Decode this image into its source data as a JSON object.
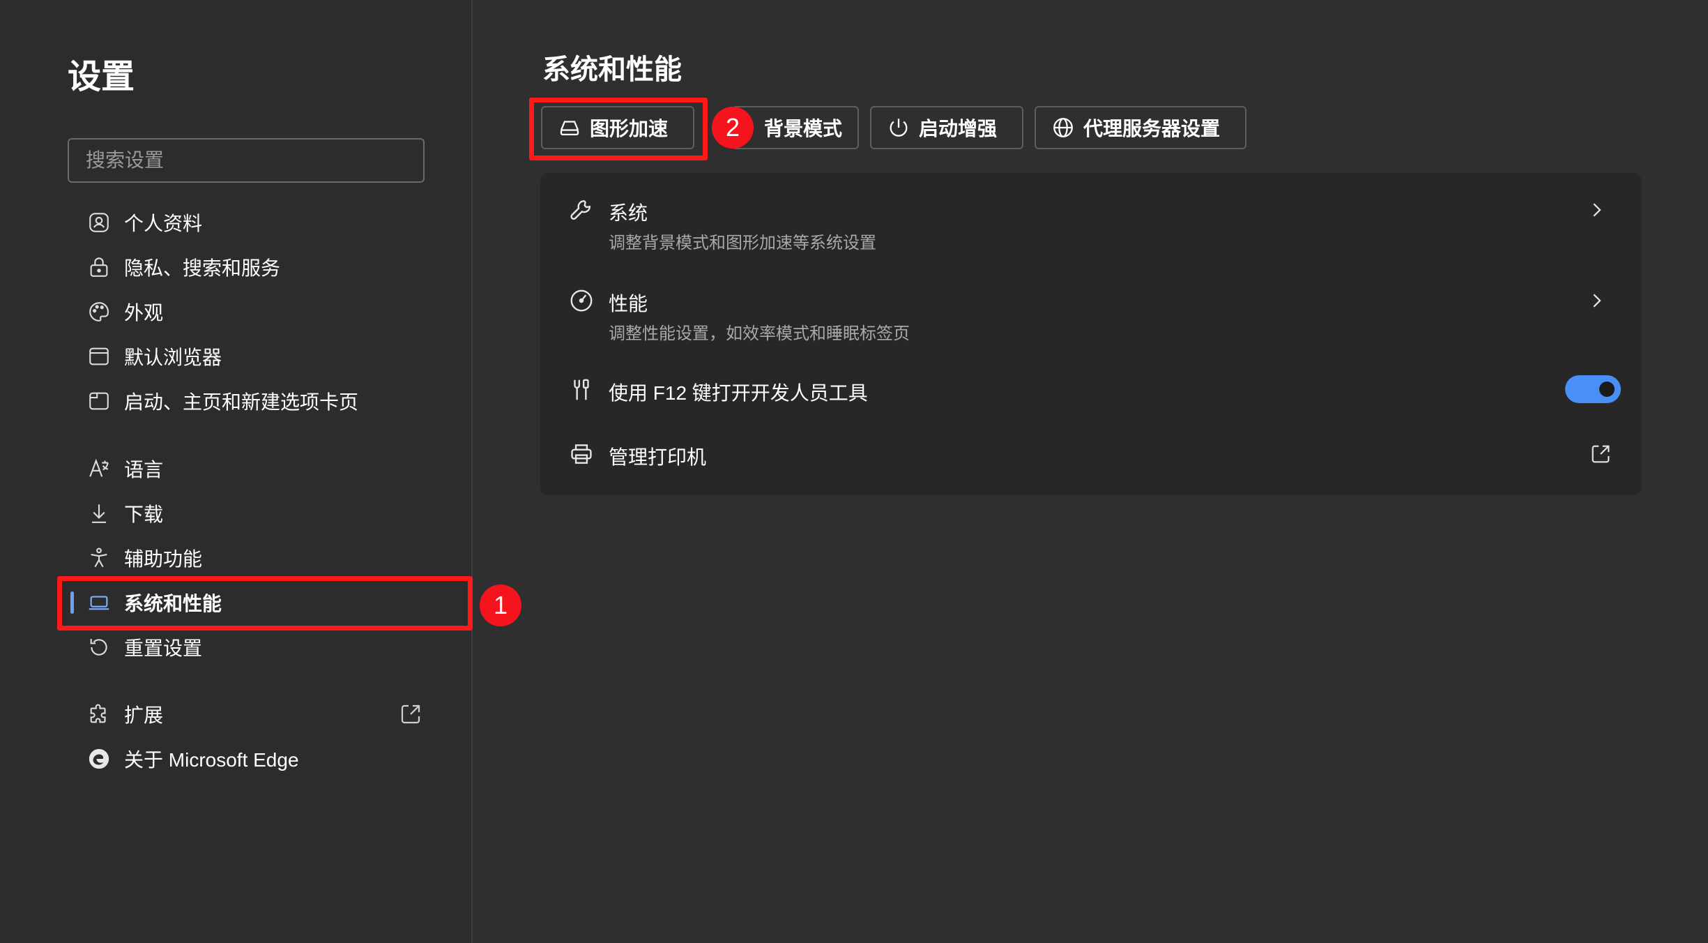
{
  "sidebar": {
    "title": "设置",
    "search_placeholder": "搜索设置",
    "items": [
      {
        "label": "个人资料",
        "icon": "profile-icon"
      },
      {
        "label": "隐私、搜索和服务",
        "icon": "lock-icon"
      },
      {
        "label": "外观",
        "icon": "palette-icon"
      },
      {
        "label": "默认浏览器",
        "icon": "browser-window-icon"
      },
      {
        "label": "启动、主页和新建选项卡页",
        "icon": "home-tab-icon"
      },
      {
        "label": "语言",
        "icon": "language-icon"
      },
      {
        "label": "下载",
        "icon": "download-icon"
      },
      {
        "label": "辅助功能",
        "icon": "accessibility-icon"
      },
      {
        "label": "系统和性能",
        "icon": "laptop-icon",
        "active": true
      },
      {
        "label": "重置设置",
        "icon": "reset-icon"
      },
      {
        "label": "扩展",
        "icon": "puzzle-icon",
        "external": true
      },
      {
        "label": "关于 Microsoft Edge",
        "icon": "edge-logo-icon"
      }
    ]
  },
  "main": {
    "title": "系统和性能",
    "quick_buttons": [
      {
        "label": "图形加速",
        "icon": "drive-icon"
      },
      {
        "label": "背景模式",
        "icon": ""
      },
      {
        "label": "启动增强",
        "icon": "power-icon"
      },
      {
        "label": "代理服务器设置",
        "icon": "globe-icon"
      }
    ],
    "rows": [
      {
        "title": "系统",
        "subtitle": "调整背景模式和图形加速等系统设置",
        "icon": "wrench-icon",
        "action": "chevron"
      },
      {
        "title": "性能",
        "subtitle": "调整性能设置，如效率模式和睡眠标签页",
        "icon": "speedometer-icon",
        "action": "chevron"
      },
      {
        "title": "使用 F12 键打开开发人员工具",
        "subtitle": "",
        "icon": "dev-tools-icon",
        "action": "toggle",
        "toggle_on": true
      },
      {
        "title": "管理打印机",
        "subtitle": "",
        "icon": "printer-icon",
        "action": "external"
      }
    ]
  },
  "annotations": {
    "step1": "1",
    "step2": "2"
  },
  "colors": {
    "accent": "#4a8ff7",
    "highlight": "#ff1a1a",
    "badge": "#f5141e",
    "background": "#2f2f2f",
    "card": "#272727"
  }
}
